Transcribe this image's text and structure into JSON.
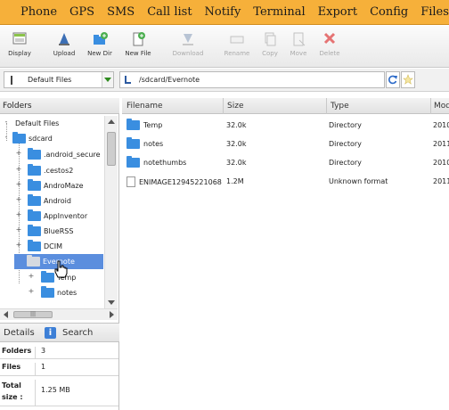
{
  "menu": [
    "Phone",
    "GPS",
    "SMS",
    "Call list",
    "Notify",
    "Terminal",
    "Export",
    "Config",
    "Files"
  ],
  "toolbar": {
    "display": "Display",
    "upload": "Upload",
    "new_dir": "New Dir",
    "new_file": "New File",
    "download": "Download",
    "rename": "Rename",
    "copy": "Copy",
    "move": "Move",
    "delete": "Delete"
  },
  "favorites": {
    "selected": "Default Files"
  },
  "path": {
    "value": "/sdcard/Evernote"
  },
  "folders_panel": {
    "title": "Folders",
    "tree": [
      "Default Files",
      "sdcard",
      ".android_secure",
      ".cestos2",
      "AndroMaze",
      "Android",
      "AppInventor",
      "BlueRSS",
      "DCIM",
      "Evernote",
      "Temp",
      "notes"
    ],
    "selected": "Evernote"
  },
  "details_tabs": {
    "details": "Details",
    "search": "Search"
  },
  "details": [
    {
      "key": "Folders",
      "value": "3"
    },
    {
      "key": "Files",
      "value": "1"
    },
    {
      "key": "Total size :",
      "value": "1.25 MB"
    }
  ],
  "file_list": {
    "columns": [
      "Filename",
      "Size",
      "Type",
      "Modified"
    ],
    "rows": [
      {
        "name": "Temp",
        "size": "32.0k",
        "type": "Directory",
        "modified": "2010",
        "kind": "folder"
      },
      {
        "name": "notes",
        "size": "32.0k",
        "type": "Directory",
        "modified": "2011",
        "kind": "folder"
      },
      {
        "name": "notethumbs",
        "size": "32.0k",
        "type": "Directory",
        "modified": "2010",
        "kind": "folder"
      },
      {
        "name": "ENIMAGE12945221068",
        "size": "1.2M",
        "type": "Unknown format",
        "modified": "2011",
        "kind": "file"
      }
    ]
  },
  "colors": {
    "menu_bg": "#f6b03a",
    "selection": "#5b8ede",
    "folder": "#3a8ee0"
  }
}
